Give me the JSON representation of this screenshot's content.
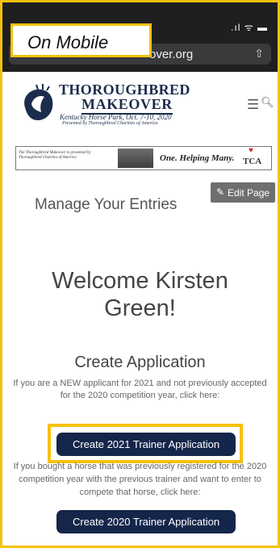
{
  "badge": "On Mobile",
  "browser": {
    "url": "over.org",
    "signal": ".ıl ᯤ ▬"
  },
  "header": {
    "brand_line1": "THOROUGHBRED",
    "brand_line2": "MAKEOVER",
    "brand_line3": "Kentucky Horse Park, Oct. 7-10, 2020",
    "brand_line4": "Presented by Thoroughbred Charities of America"
  },
  "banner": {
    "left_text": "The Thoroughbred Makeover is presented by Thoroughbred Charities of America",
    "tagline": "One. Helping Many.",
    "logo_text": "TCA"
  },
  "edit_label": "Edit Page",
  "page_title": "Manage Your Entries",
  "welcome": "Welcome Kirsten Green!",
  "section_title": "Create Application",
  "para1": "If you are a NEW applicant for 2021 and not previously accepted for the 2020 competition year, click here:",
  "btn1_label": "Create 2021 Trainer Application",
  "para2": "If you bought a horse that was previously registered for the 2020 competition year with the previous trainer and want to enter to compete that horse, click here:",
  "btn2_label": "Create 2020 Trainer Application"
}
